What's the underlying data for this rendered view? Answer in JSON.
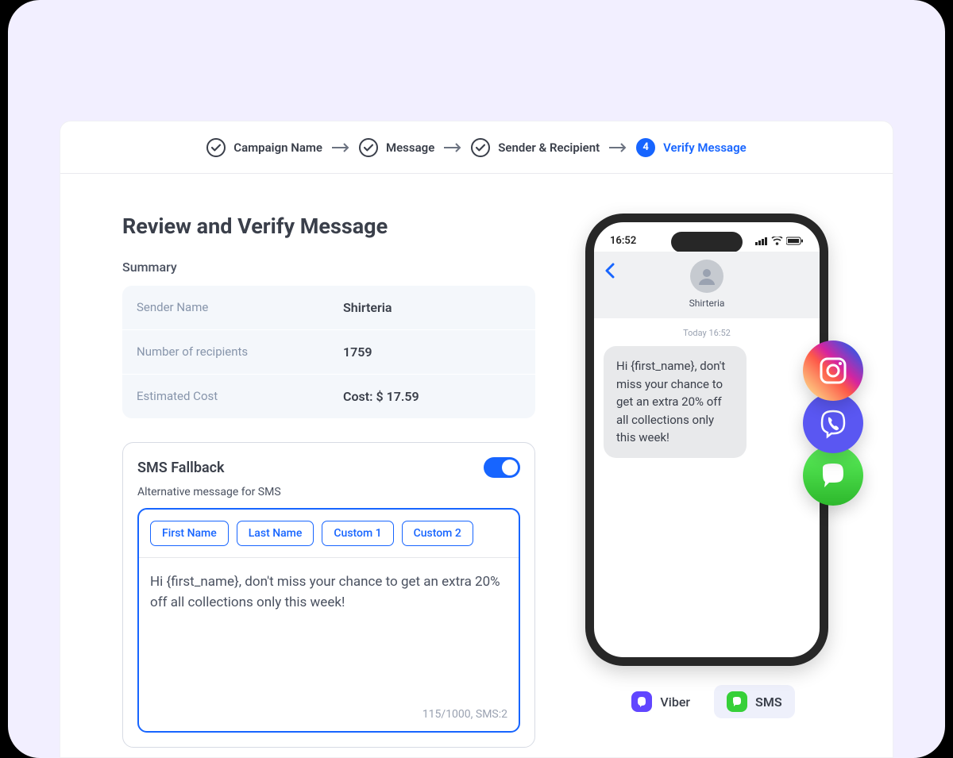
{
  "stepper": {
    "steps": [
      {
        "label": "Campaign Name",
        "done": true
      },
      {
        "label": "Message",
        "done": true
      },
      {
        "label": "Sender & Recipient",
        "done": true
      },
      {
        "label": "Verify Message",
        "done": false,
        "active": true,
        "num": "4"
      }
    ]
  },
  "page": {
    "title": "Review and Verify Message",
    "summary_heading": "Summary"
  },
  "summary": {
    "rows": [
      {
        "label": "Sender Name",
        "value": "Shirteria"
      },
      {
        "label": "Number of recipients",
        "value": "1759"
      },
      {
        "label": "Estimated Cost",
        "value": "Cost: $ 17.59"
      }
    ]
  },
  "fallback": {
    "title": "SMS Fallback",
    "enabled": true,
    "subtitle": "Alternative message for SMS",
    "chips": [
      "First Name",
      "Last Name",
      "Custom 1",
      "Custom 2"
    ],
    "message": "Hi {first_name}, don't miss your chance to get an extra 20% off all collections only this week!",
    "counter": "115/1000, SMS:2"
  },
  "preview": {
    "time": "16:52",
    "sender": "Shirteria",
    "timestamp": "Today 16:52",
    "bubble": "Hi {first_name}, don't miss your chance to get an extra 20% off all collections only this week!"
  },
  "side_channels": [
    "instagram",
    "viber",
    "sms"
  ],
  "channel_options": [
    {
      "icon": "viber",
      "label": "Viber",
      "active": false
    },
    {
      "icon": "sms",
      "label": "SMS",
      "active": true
    }
  ]
}
